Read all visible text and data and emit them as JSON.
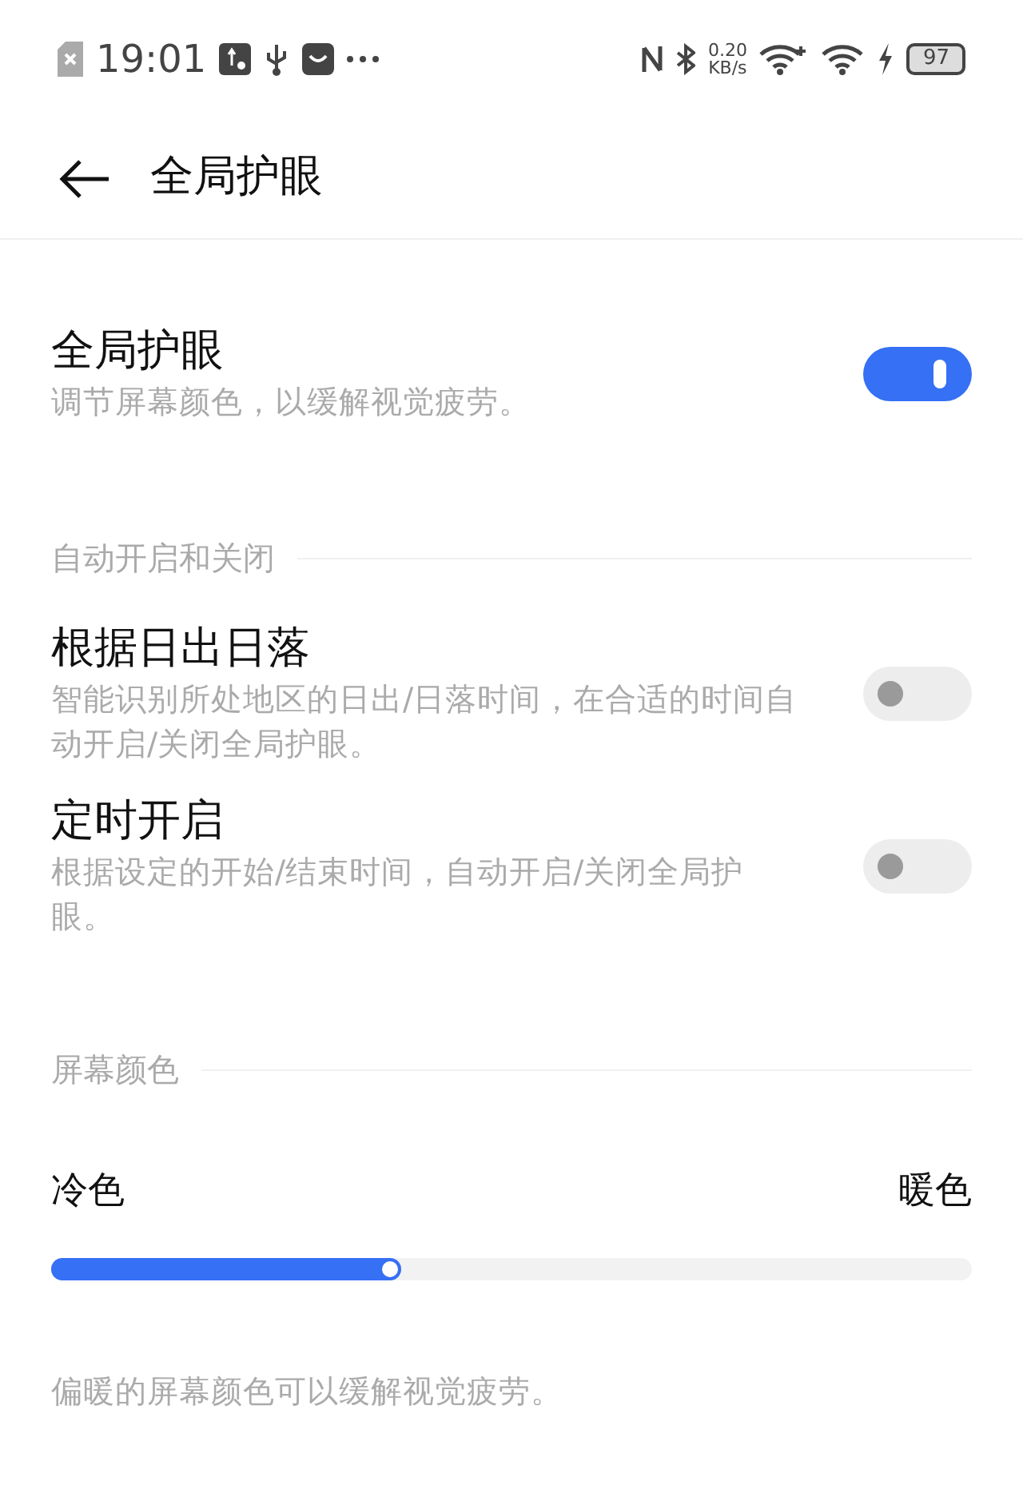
{
  "status_bar": {
    "time": "19:01",
    "speed_value": "0.20",
    "speed_unit": "KB/s",
    "battery": "97"
  },
  "header": {
    "title": "全局护眼"
  },
  "main_toggle": {
    "title": "全局护眼",
    "subtitle": "调节屏幕颜色，以缓解视觉疲劳。",
    "on": true
  },
  "auto_section": {
    "heading": "自动开启和关闭",
    "items": [
      {
        "title": "根据日出日落",
        "subtitle": "智能识别所处地区的日出/日落时间，在合适的时间自动开启/关闭全局护眼。",
        "on": false
      },
      {
        "title": "定时开启",
        "subtitle": "根据设定的开始/结束时间，自动开启/关闭全局护眼。",
        "on": false
      }
    ]
  },
  "color_section": {
    "heading": "屏幕颜色",
    "min_label": "冷色",
    "max_label": "暖色",
    "level": 0.38,
    "note": "偏暖的屏幕颜色可以缓解视觉疲劳。"
  }
}
